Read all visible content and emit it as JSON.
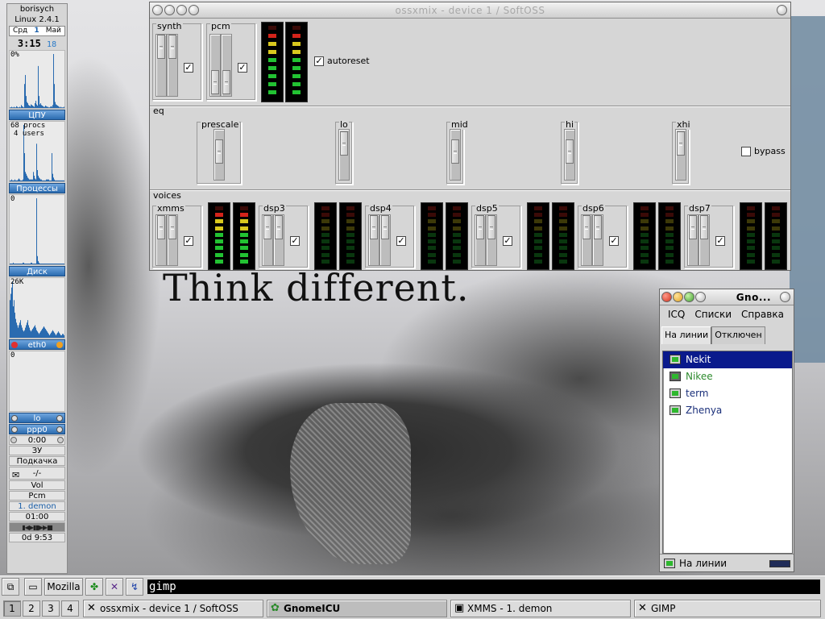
{
  "wallpaper": {
    "slogan": "Think different."
  },
  "gkrellm": {
    "host": "borisych",
    "kernel": "Linux 2.4.1",
    "date": {
      "weekday": "Срд",
      "day": "1",
      "month": "Май"
    },
    "clock": {
      "time": "3:15",
      "seconds": "18"
    },
    "cpu": {
      "percent": "0%",
      "label": "ЦПУ",
      "values": [
        1,
        1,
        2,
        1,
        1,
        2,
        1,
        1,
        3,
        2,
        1,
        1,
        2,
        1,
        5,
        3,
        2,
        1,
        40,
        55,
        20,
        10,
        8,
        5,
        4,
        3,
        6,
        5,
        4,
        3,
        2,
        8,
        12,
        6,
        4,
        70,
        20,
        6,
        8,
        5,
        4,
        3,
        2,
        2,
        4,
        3,
        2,
        2,
        1,
        1,
        2,
        3,
        2,
        5,
        90,
        40,
        10,
        6,
        5,
        4,
        3,
        2,
        1,
        2,
        1,
        1,
        1,
        2,
        1,
        1
      ]
    },
    "procs": {
      "label": "Процессы",
      "procs": "68 procs",
      "users": "4 users",
      "values": [
        1,
        1,
        2,
        1,
        1,
        1,
        2,
        1,
        1,
        1,
        2,
        3,
        2,
        1,
        1,
        1,
        2,
        60,
        30,
        10,
        8,
        6,
        4,
        3,
        2,
        2,
        2,
        2,
        2,
        10,
        6,
        3,
        2,
        40,
        12,
        6,
        4,
        3,
        2,
        2,
        1,
        1,
        1,
        1,
        1,
        2,
        2,
        2,
        2,
        1,
        1,
        1,
        30,
        8,
        4,
        2,
        1,
        1,
        1,
        1,
        1,
        1,
        1,
        1,
        1,
        1,
        1,
        1,
        1,
        1
      ]
    },
    "disk": {
      "label": "Диск",
      "top": "0",
      "values": [
        1,
        1,
        1,
        1,
        2,
        1,
        1,
        1,
        1,
        1,
        1,
        1,
        1,
        1,
        1,
        1,
        2,
        2,
        1,
        1,
        1,
        1,
        1,
        1,
        1,
        1,
        2,
        2,
        1,
        1,
        1,
        1,
        1,
        80,
        10,
        4,
        2,
        1,
        1,
        1,
        1,
        1,
        1,
        1,
        1,
        1,
        1,
        1,
        1,
        1,
        1,
        1,
        1,
        1,
        1,
        1,
        1,
        1,
        1,
        1,
        1,
        1,
        1,
        1,
        1,
        1,
        1,
        1,
        1,
        1
      ]
    },
    "eth0": {
      "label": "eth0",
      "top": "26K",
      "values": [
        30,
        35,
        40,
        45,
        25,
        30,
        20,
        15,
        12,
        10,
        8,
        10,
        12,
        14,
        10,
        8,
        6,
        5,
        6,
        8,
        10,
        12,
        14,
        10,
        8,
        6,
        5,
        6,
        7,
        8,
        9,
        10,
        8,
        6,
        5,
        4,
        3,
        4,
        5,
        6,
        7,
        8,
        9,
        8,
        7,
        6,
        5,
        4,
        3,
        2,
        3,
        4,
        5,
        6,
        5,
        4,
        3,
        2,
        3,
        4,
        5,
        4,
        3,
        2,
        2,
        3,
        3,
        2,
        2,
        2
      ]
    },
    "ppp_chart": {
      "top": "0"
    },
    "lo": "lo",
    "ppp0": "ppp0",
    "ppp_time": "0:00",
    "mem": "ЗУ",
    "swap": "Подкачка",
    "mail": "-/-",
    "vol": "Vol",
    "pcm": "Pcm",
    "xmms_track": "1. demon",
    "xmms_time": "01:00",
    "uptime": "0d  9:53"
  },
  "mixer": {
    "title": "ossxmix - device 1 / SoftOSS",
    "synth": {
      "label": "synth",
      "enabled": true
    },
    "pcm": {
      "label": "pcm",
      "enabled": true
    },
    "autoreset": {
      "label": "autoreset",
      "checked": true
    },
    "eq": {
      "label": "eq",
      "prescale": "prescale",
      "lo": "lo",
      "mid": "mid",
      "hi": "hi",
      "xhi": "xhi",
      "bypass": {
        "label": "bypass",
        "checked": false
      }
    },
    "voices": {
      "label": "voices",
      "channels": [
        {
          "name": "xmms",
          "enabled": true
        },
        {
          "name": "dsp3",
          "enabled": true
        },
        {
          "name": "dsp4",
          "enabled": true
        },
        {
          "name": "dsp5",
          "enabled": true
        },
        {
          "name": "dsp6",
          "enabled": true
        },
        {
          "name": "dsp7",
          "enabled": true
        }
      ]
    }
  },
  "gnomeicu": {
    "title": "Gno...",
    "menu": [
      "ICQ",
      "Списки",
      "Справка"
    ],
    "tabs": [
      "На линии",
      "Отключен"
    ],
    "contacts": [
      {
        "name": "Nekit",
        "selected": true
      },
      {
        "name": "Nikee",
        "color": "#2e8b2e"
      },
      {
        "name": "term"
      },
      {
        "name": "Zhenya"
      }
    ],
    "status": "На линии"
  },
  "panel": {
    "launchers": {
      "mozilla": "Mozilla"
    },
    "command": "gimp",
    "workspaces": [
      "1",
      "2",
      "3",
      "4"
    ],
    "active_workspace": "1",
    "tasks": [
      {
        "label": "ossxmix - device 1 / SoftOSS",
        "icon": "x-icon"
      },
      {
        "label": "GnomeICU",
        "icon": "gnomeicu-icon",
        "active": true
      },
      {
        "label": "XMMS - 1. demon",
        "icon": "xmms-icon"
      },
      {
        "label": "GIMP",
        "icon": "x-icon"
      }
    ]
  },
  "colors": {
    "meter_green": "#22c232",
    "meter_yellow": "#d9c81e",
    "meter_red": "#d2231a",
    "gkrellm_bar": "#2a6bb0",
    "selection": "#0a1a8c"
  }
}
